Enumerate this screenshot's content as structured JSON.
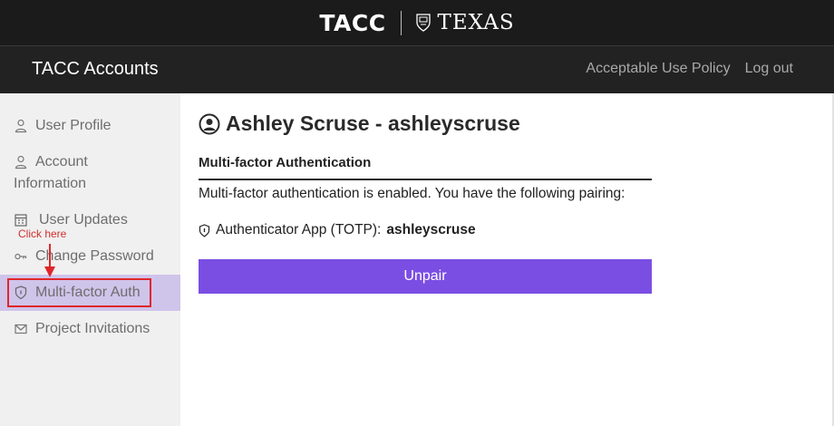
{
  "banner": {
    "tacc_logo": "TACC",
    "texas_logo": "TEXAS",
    "seal_icon": "ut-seal-icon"
  },
  "navbar": {
    "brand": "TACC Accounts",
    "links": [
      "Acceptable Use Policy",
      "Log out"
    ]
  },
  "sidebar": {
    "items": [
      {
        "label": "User Profile",
        "icon": "person-icon"
      },
      {
        "label": "Account",
        "label2": "Information",
        "icon": "person-icon"
      },
      {
        "label": "User Updates",
        "icon": "calendar-icon"
      },
      {
        "label": "Change Password",
        "icon": "key-icon"
      },
      {
        "label": "Multi-factor Auth",
        "icon": "shield-icon",
        "active": true
      },
      {
        "label": "Project Invitations",
        "icon": "envelope-icon"
      }
    ],
    "annotation": "Click here"
  },
  "main": {
    "title": "Ashley Scruse - ashleyscruse",
    "section_title": "Multi-factor Authentication",
    "description": "Multi-factor authentication is enabled. You have the following pairing:",
    "pairing_label": "Authenticator App (TOTP):",
    "pairing_value": "ashleyscruse",
    "unpair_button": "Unpair"
  },
  "colors": {
    "banner_bg": "#1b1b1b",
    "navbar_bg": "#222222",
    "sidebar_bg": "#f0f0f0",
    "active_item_bg": "#cfc4ea",
    "accent": "#7b4ee3",
    "annotation": "#e0262b"
  }
}
